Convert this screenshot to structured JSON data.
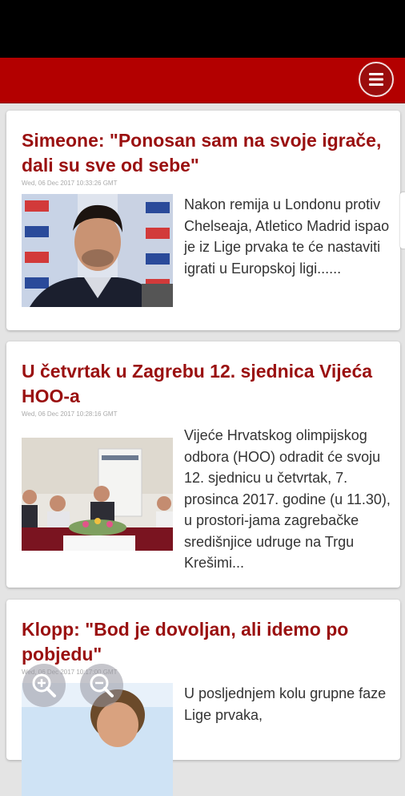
{
  "articles": [
    {
      "title": "Simeone: \"Ponosan sam na svoje igrače, dali su sve od sebe\"",
      "date": "Wed, 06 Dec 2017 10:33:26 GMT",
      "snippet": "Nakon remija u Londonu protiv Chelseaja, Atletico Madrid ispao je iz Lige prvaka te će nastaviti igrati u Europskoj ligi......",
      "image": "press-conference-photo"
    },
    {
      "title": "U četvrtak u Zagrebu 12. sjednica Vijeća HOO-a",
      "date": "Wed, 06 Dec 2017 10:28:16 GMT",
      "snippet": "Vijeće Hrvatskog olimpijskog odbora (HOO) odradit će svoju 12. sjednicu u četvrtak, 7. prosinca 2017. godine (u 11.30), u prostori-jama zagrebačke središnjice udruge na Trgu Krešimi...",
      "image": "council-meeting-photo"
    },
    {
      "title": "Klopp: \"Bod je dovoljan, ali idemo po pobjedu\"",
      "date": "Wed, 06 Dec 2017 10:17:00 GMT",
      "snippet": "U posljednjem kolu grupne faze Lige prvaka,",
      "image": "klopp-photo"
    }
  ],
  "icons": {
    "menu": "hamburger-menu-icon",
    "zoom_in": "zoom-in-icon",
    "zoom_out": "zoom-out-icon"
  },
  "colors": {
    "appbar": "#b30000",
    "title": "#9a1010"
  }
}
